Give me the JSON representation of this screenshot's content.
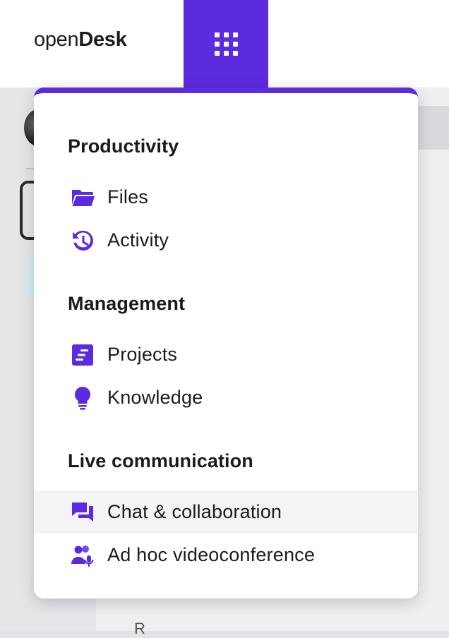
{
  "header": {
    "logo_light": "open",
    "logo_bold": "Desk",
    "apps_button": "apps-grid"
  },
  "menu": {
    "accent": "#5b2bdd",
    "sections": [
      {
        "title": "Productivity",
        "items": [
          {
            "label": "Files",
            "icon": "folder-icon"
          },
          {
            "label": "Activity",
            "icon": "history-icon"
          }
        ]
      },
      {
        "title": "Management",
        "items": [
          {
            "label": "Projects",
            "icon": "projects-icon"
          },
          {
            "label": "Knowledge",
            "icon": "lightbulb-icon"
          }
        ]
      },
      {
        "title": "Live communication",
        "items": [
          {
            "label": "Chat & collaboration",
            "icon": "chat-icon",
            "highlighted": true
          },
          {
            "label": "Ad hoc videoconference",
            "icon": "video-users-icon"
          }
        ]
      }
    ]
  },
  "background": {
    "partial_text": "R"
  }
}
